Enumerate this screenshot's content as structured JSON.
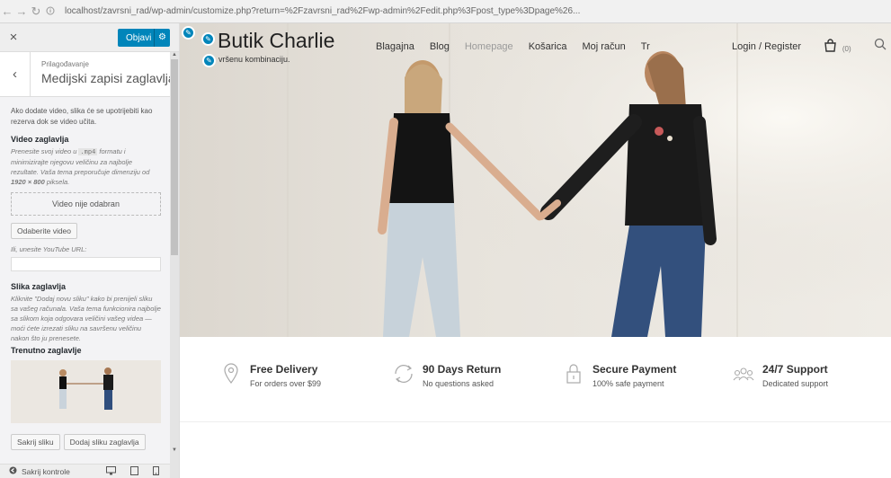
{
  "browser": {
    "back_glyph": "←",
    "forward_glyph": "→",
    "reload_glyph": "↻",
    "url": "localhost/zavrsni_rad/wp-admin/customize.php?return=%2Fzavrsni_rad%2Fwp-admin%2Fedit.php%3Fpost_type%3Dpage%26..."
  },
  "sidebar": {
    "close_glyph": "×",
    "publish_label": "Objavi",
    "back_glyph": "‹",
    "breadcrumb": "Prilagođavanje",
    "title": "Medijski zapisi zaglavlja",
    "intro": "Ako dodate video, slika će se upotrijebiti kao rezerva dok se video učita.",
    "video_heading": "Video zaglavlja",
    "video_hint_pre": "Prenesite svoj video u",
    "video_hint_code": ".mp4",
    "video_hint_post": "formatu i minimizirajte njegovu veličinu za najbolje rezultate. Vaša tema preporučuje dimenziju od",
    "video_hint_dims": "1920 × 800",
    "video_hint_end": "piksela.",
    "no_video": "Video nije odabran",
    "choose_video": "Odaberite video",
    "youtube_label": "Ili, unesite YouTube URL:",
    "youtube_value": "",
    "image_heading": "Slika zaglavlja",
    "image_hint": "Kliknite \"Dodaj novu sliku\" kako bi prenijeli sliku sa vašeg računala. Vaša tema funkcionira najbolje sa slikom koja odgovara veličini vašeg videa — moći ćete izrezati sliku na savršenu veličinu nakon što ju prenesete.",
    "current_heading": "Trenutno zaglavlje",
    "hide_image": "Sakrij sliku",
    "add_header_image": "Dodaj sliku zaglavlja",
    "hide_controls": "Sakrij kontrole"
  },
  "site": {
    "name": "Butik Charlie",
    "tagline": "vršenu kombinaciju.",
    "nav": [
      {
        "label": "Blagajna"
      },
      {
        "label": "Blog"
      },
      {
        "label": "Homepage"
      },
      {
        "label": "Košarica"
      },
      {
        "label": "Moj račun"
      },
      {
        "label": "Tr"
      }
    ],
    "login": "Login / Register",
    "cart_count": "(0)"
  },
  "features": [
    {
      "icon": "location-pin-icon",
      "title": "Free Delivery",
      "subtitle": "For orders over $99"
    },
    {
      "icon": "refresh-icon",
      "title": "90 Days Return",
      "subtitle": "No questions asked"
    },
    {
      "icon": "lock-icon",
      "title": "Secure Payment",
      "subtitle": "100% safe payment"
    },
    {
      "icon": "support-group-icon",
      "title": "24/7 Support",
      "subtitle": "Dedicated support"
    }
  ],
  "colors": {
    "publish_blue": "#0085ba"
  }
}
